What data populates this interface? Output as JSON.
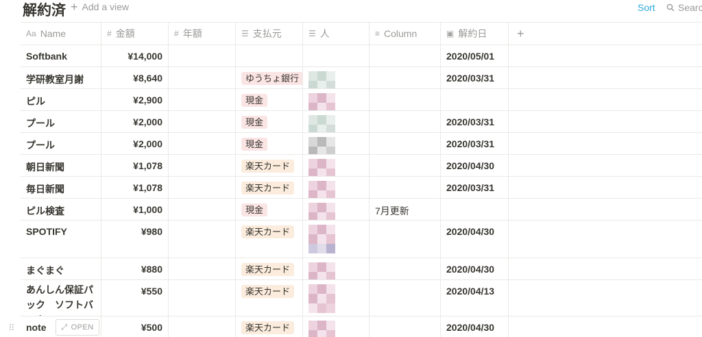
{
  "view": {
    "title": "解約済",
    "add_view": "Add a view",
    "sort": "Sort",
    "search": "Search"
  },
  "columns": [
    {
      "icon": "text-type-icon",
      "glyph": "Aa",
      "label": "Name"
    },
    {
      "icon": "number-icon",
      "glyph": "#",
      "label": "金額"
    },
    {
      "icon": "number-icon",
      "glyph": "#",
      "label": "年額"
    },
    {
      "icon": "list-icon",
      "glyph": "☰",
      "label": "支払元"
    },
    {
      "icon": "list-icon",
      "glyph": "☰",
      "label": "人"
    },
    {
      "icon": "text-lines-icon",
      "glyph": "≡",
      "label": "Column"
    },
    {
      "icon": "calendar-icon",
      "glyph": "▣",
      "label": "解約日"
    }
  ],
  "add_column_glyph": "+",
  "rows": [
    {
      "name": "Softbank",
      "amount": "¥14,000",
      "payment": "",
      "payment_color": "",
      "column": "",
      "date": "2020/05/01",
      "person": ""
    },
    {
      "name": "学研教室月謝",
      "amount": "¥8,640",
      "payment": "ゆうちょ銀行",
      "payment_color": "bank",
      "column": "",
      "date": "2020/03/31",
      "person": "green"
    },
    {
      "name": "ピル",
      "amount": "¥2,900",
      "payment": "現金",
      "payment_color": "cash",
      "column": "",
      "date": "",
      "person": "pink"
    },
    {
      "name": "プール",
      "amount": "¥2,000",
      "payment": "現金",
      "payment_color": "cash",
      "column": "",
      "date": "2020/03/31",
      "person": "green"
    },
    {
      "name": "プール",
      "amount": "¥2,000",
      "payment": "現金",
      "payment_color": "cash",
      "column": "",
      "date": "2020/03/31",
      "person": "gray"
    },
    {
      "name": "朝日新聞",
      "amount": "¥1,078",
      "payment": "楽天カード",
      "payment_color": "rakuten",
      "column": "",
      "date": "2020/04/30",
      "person": "pink"
    },
    {
      "name": "毎日新聞",
      "amount": "¥1,078",
      "payment": "楽天カード",
      "payment_color": "rakuten",
      "column": "",
      "date": "2020/03/31",
      "person": "pink"
    },
    {
      "name": "ピル検査",
      "amount": "¥1,000",
      "payment": "現金",
      "payment_color": "cash",
      "column": "7月更新",
      "date": "",
      "person": "pink"
    },
    {
      "name": "SPOTIFY",
      "amount": "¥980",
      "payment": "楽天カード",
      "payment_color": "rakuten",
      "column": "",
      "date": "2020/04/30",
      "person": "pinkpurple"
    },
    {
      "name": "まぐまぐ",
      "amount": "¥880",
      "payment": "楽天カード",
      "payment_color": "rakuten",
      "column": "",
      "date": "2020/04/30",
      "person": "pink"
    },
    {
      "name": "あんしん保証パック　ソフトバンク",
      "amount": "¥550",
      "payment": "楽天カード",
      "payment_color": "rakuten",
      "column": "",
      "date": "2020/04/13",
      "person": "pink2"
    },
    {
      "name": "note",
      "amount": "¥500",
      "payment": "楽天カード",
      "payment_color": "rakuten",
      "column": "",
      "date": "2020/04/30",
      "person": "pink"
    }
  ],
  "open_button": "OPEN",
  "colors": {
    "tag_cash": "#fbe4e4",
    "tag_rakuten": "#fbecdd",
    "accent": "#2eaadc",
    "mosaic_green": [
      "#dfe7e3",
      "#cbd9d3",
      "#e9efec",
      "#d4ddd9"
    ],
    "mosaic_pink": [
      "#ecd3dd",
      "#dcb6c6",
      "#f4e3ea",
      "#e6c4d2"
    ],
    "mosaic_gray": [
      "#d8d8d8",
      "#b9b9b9",
      "#e6e6e6",
      "#cfcfcf"
    ],
    "mosaic_purple": [
      "#b9b3cf",
      "#9f98bd",
      "#cfc9e0",
      "#e0dcea"
    ]
  }
}
